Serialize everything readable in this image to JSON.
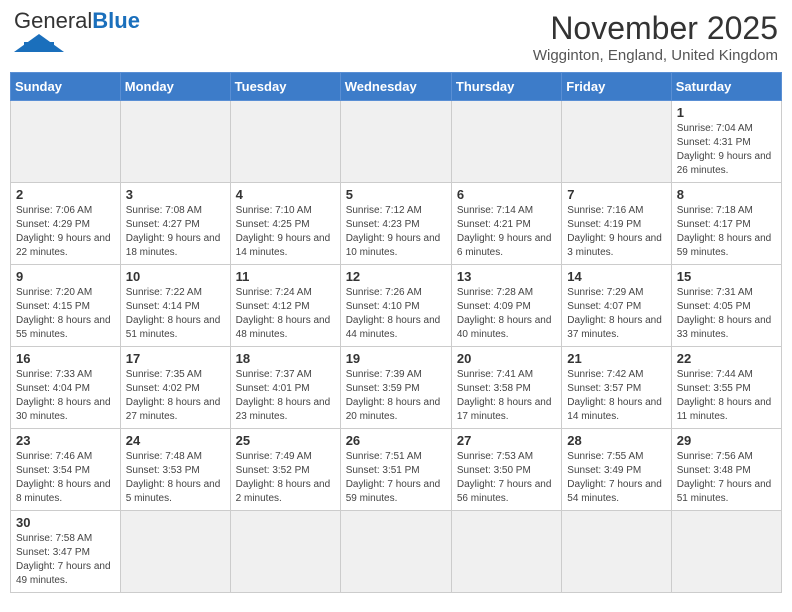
{
  "logo": {
    "general": "General",
    "blue": "Blue"
  },
  "header": {
    "month": "November 2025",
    "location": "Wigginton, England, United Kingdom"
  },
  "days_of_week": [
    "Sunday",
    "Monday",
    "Tuesday",
    "Wednesday",
    "Thursday",
    "Friday",
    "Saturday"
  ],
  "weeks": [
    [
      {
        "day": "",
        "info": ""
      },
      {
        "day": "",
        "info": ""
      },
      {
        "day": "",
        "info": ""
      },
      {
        "day": "",
        "info": ""
      },
      {
        "day": "",
        "info": ""
      },
      {
        "day": "",
        "info": ""
      },
      {
        "day": "1",
        "info": "Sunrise: 7:04 AM\nSunset: 4:31 PM\nDaylight: 9 hours and 26 minutes."
      }
    ],
    [
      {
        "day": "2",
        "info": "Sunrise: 7:06 AM\nSunset: 4:29 PM\nDaylight: 9 hours and 22 minutes."
      },
      {
        "day": "3",
        "info": "Sunrise: 7:08 AM\nSunset: 4:27 PM\nDaylight: 9 hours and 18 minutes."
      },
      {
        "day": "4",
        "info": "Sunrise: 7:10 AM\nSunset: 4:25 PM\nDaylight: 9 hours and 14 minutes."
      },
      {
        "day": "5",
        "info": "Sunrise: 7:12 AM\nSunset: 4:23 PM\nDaylight: 9 hours and 10 minutes."
      },
      {
        "day": "6",
        "info": "Sunrise: 7:14 AM\nSunset: 4:21 PM\nDaylight: 9 hours and 6 minutes."
      },
      {
        "day": "7",
        "info": "Sunrise: 7:16 AM\nSunset: 4:19 PM\nDaylight: 9 hours and 3 minutes."
      },
      {
        "day": "8",
        "info": "Sunrise: 7:18 AM\nSunset: 4:17 PM\nDaylight: 8 hours and 59 minutes."
      }
    ],
    [
      {
        "day": "9",
        "info": "Sunrise: 7:20 AM\nSunset: 4:15 PM\nDaylight: 8 hours and 55 minutes."
      },
      {
        "day": "10",
        "info": "Sunrise: 7:22 AM\nSunset: 4:14 PM\nDaylight: 8 hours and 51 minutes."
      },
      {
        "day": "11",
        "info": "Sunrise: 7:24 AM\nSunset: 4:12 PM\nDaylight: 8 hours and 48 minutes."
      },
      {
        "day": "12",
        "info": "Sunrise: 7:26 AM\nSunset: 4:10 PM\nDaylight: 8 hours and 44 minutes."
      },
      {
        "day": "13",
        "info": "Sunrise: 7:28 AM\nSunset: 4:09 PM\nDaylight: 8 hours and 40 minutes."
      },
      {
        "day": "14",
        "info": "Sunrise: 7:29 AM\nSunset: 4:07 PM\nDaylight: 8 hours and 37 minutes."
      },
      {
        "day": "15",
        "info": "Sunrise: 7:31 AM\nSunset: 4:05 PM\nDaylight: 8 hours and 33 minutes."
      }
    ],
    [
      {
        "day": "16",
        "info": "Sunrise: 7:33 AM\nSunset: 4:04 PM\nDaylight: 8 hours and 30 minutes."
      },
      {
        "day": "17",
        "info": "Sunrise: 7:35 AM\nSunset: 4:02 PM\nDaylight: 8 hours and 27 minutes."
      },
      {
        "day": "18",
        "info": "Sunrise: 7:37 AM\nSunset: 4:01 PM\nDaylight: 8 hours and 23 minutes."
      },
      {
        "day": "19",
        "info": "Sunrise: 7:39 AM\nSunset: 3:59 PM\nDaylight: 8 hours and 20 minutes."
      },
      {
        "day": "20",
        "info": "Sunrise: 7:41 AM\nSunset: 3:58 PM\nDaylight: 8 hours and 17 minutes."
      },
      {
        "day": "21",
        "info": "Sunrise: 7:42 AM\nSunset: 3:57 PM\nDaylight: 8 hours and 14 minutes."
      },
      {
        "day": "22",
        "info": "Sunrise: 7:44 AM\nSunset: 3:55 PM\nDaylight: 8 hours and 11 minutes."
      }
    ],
    [
      {
        "day": "23",
        "info": "Sunrise: 7:46 AM\nSunset: 3:54 PM\nDaylight: 8 hours and 8 minutes."
      },
      {
        "day": "24",
        "info": "Sunrise: 7:48 AM\nSunset: 3:53 PM\nDaylight: 8 hours and 5 minutes."
      },
      {
        "day": "25",
        "info": "Sunrise: 7:49 AM\nSunset: 3:52 PM\nDaylight: 8 hours and 2 minutes."
      },
      {
        "day": "26",
        "info": "Sunrise: 7:51 AM\nSunset: 3:51 PM\nDaylight: 7 hours and 59 minutes."
      },
      {
        "day": "27",
        "info": "Sunrise: 7:53 AM\nSunset: 3:50 PM\nDaylight: 7 hours and 56 minutes."
      },
      {
        "day": "28",
        "info": "Sunrise: 7:55 AM\nSunset: 3:49 PM\nDaylight: 7 hours and 54 minutes."
      },
      {
        "day": "29",
        "info": "Sunrise: 7:56 AM\nSunset: 3:48 PM\nDaylight: 7 hours and 51 minutes."
      }
    ],
    [
      {
        "day": "30",
        "info": "Sunrise: 7:58 AM\nSunset: 3:47 PM\nDaylight: 7 hours and 49 minutes."
      },
      {
        "day": "",
        "info": ""
      },
      {
        "day": "",
        "info": ""
      },
      {
        "day": "",
        "info": ""
      },
      {
        "day": "",
        "info": ""
      },
      {
        "day": "",
        "info": ""
      },
      {
        "day": "",
        "info": ""
      }
    ]
  ]
}
